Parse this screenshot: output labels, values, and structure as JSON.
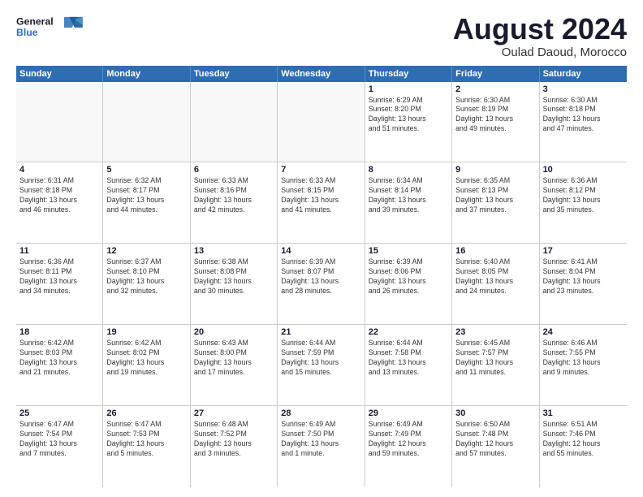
{
  "logo": {
    "text_general": "General",
    "text_blue": "Blue"
  },
  "title": {
    "month_year": "August 2024",
    "location": "Oulad Daoud, Morocco"
  },
  "header_days": [
    "Sunday",
    "Monday",
    "Tuesday",
    "Wednesday",
    "Thursday",
    "Friday",
    "Saturday"
  ],
  "weeks": [
    [
      {
        "day": "",
        "info": "",
        "empty": true
      },
      {
        "day": "",
        "info": "",
        "empty": true
      },
      {
        "day": "",
        "info": "",
        "empty": true
      },
      {
        "day": "",
        "info": "",
        "empty": true
      },
      {
        "day": "1",
        "info": "Sunrise: 6:29 AM\nSunset: 8:20 PM\nDaylight: 13 hours\nand 51 minutes.",
        "empty": false
      },
      {
        "day": "2",
        "info": "Sunrise: 6:30 AM\nSunset: 8:19 PM\nDaylight: 13 hours\nand 49 minutes.",
        "empty": false
      },
      {
        "day": "3",
        "info": "Sunrise: 6:30 AM\nSunset: 8:18 PM\nDaylight: 13 hours\nand 47 minutes.",
        "empty": false
      }
    ],
    [
      {
        "day": "4",
        "info": "Sunrise: 6:31 AM\nSunset: 8:18 PM\nDaylight: 13 hours\nand 46 minutes.",
        "empty": false
      },
      {
        "day": "5",
        "info": "Sunrise: 6:32 AM\nSunset: 8:17 PM\nDaylight: 13 hours\nand 44 minutes.",
        "empty": false
      },
      {
        "day": "6",
        "info": "Sunrise: 6:33 AM\nSunset: 8:16 PM\nDaylight: 13 hours\nand 42 minutes.",
        "empty": false
      },
      {
        "day": "7",
        "info": "Sunrise: 6:33 AM\nSunset: 8:15 PM\nDaylight: 13 hours\nand 41 minutes.",
        "empty": false
      },
      {
        "day": "8",
        "info": "Sunrise: 6:34 AM\nSunset: 8:14 PM\nDaylight: 13 hours\nand 39 minutes.",
        "empty": false
      },
      {
        "day": "9",
        "info": "Sunrise: 6:35 AM\nSunset: 8:13 PM\nDaylight: 13 hours\nand 37 minutes.",
        "empty": false
      },
      {
        "day": "10",
        "info": "Sunrise: 6:36 AM\nSunset: 8:12 PM\nDaylight: 13 hours\nand 35 minutes.",
        "empty": false
      }
    ],
    [
      {
        "day": "11",
        "info": "Sunrise: 6:36 AM\nSunset: 8:11 PM\nDaylight: 13 hours\nand 34 minutes.",
        "empty": false
      },
      {
        "day": "12",
        "info": "Sunrise: 6:37 AM\nSunset: 8:10 PM\nDaylight: 13 hours\nand 32 minutes.",
        "empty": false
      },
      {
        "day": "13",
        "info": "Sunrise: 6:38 AM\nSunset: 8:08 PM\nDaylight: 13 hours\nand 30 minutes.",
        "empty": false
      },
      {
        "day": "14",
        "info": "Sunrise: 6:39 AM\nSunset: 8:07 PM\nDaylight: 13 hours\nand 28 minutes.",
        "empty": false
      },
      {
        "day": "15",
        "info": "Sunrise: 6:39 AM\nSunset: 8:06 PM\nDaylight: 13 hours\nand 26 minutes.",
        "empty": false
      },
      {
        "day": "16",
        "info": "Sunrise: 6:40 AM\nSunset: 8:05 PM\nDaylight: 13 hours\nand 24 minutes.",
        "empty": false
      },
      {
        "day": "17",
        "info": "Sunrise: 6:41 AM\nSunset: 8:04 PM\nDaylight: 13 hours\nand 23 minutes.",
        "empty": false
      }
    ],
    [
      {
        "day": "18",
        "info": "Sunrise: 6:42 AM\nSunset: 8:03 PM\nDaylight: 13 hours\nand 21 minutes.",
        "empty": false
      },
      {
        "day": "19",
        "info": "Sunrise: 6:42 AM\nSunset: 8:02 PM\nDaylight: 13 hours\nand 19 minutes.",
        "empty": false
      },
      {
        "day": "20",
        "info": "Sunrise: 6:43 AM\nSunset: 8:00 PM\nDaylight: 13 hours\nand 17 minutes.",
        "empty": false
      },
      {
        "day": "21",
        "info": "Sunrise: 6:44 AM\nSunset: 7:59 PM\nDaylight: 13 hours\nand 15 minutes.",
        "empty": false
      },
      {
        "day": "22",
        "info": "Sunrise: 6:44 AM\nSunset: 7:58 PM\nDaylight: 13 hours\nand 13 minutes.",
        "empty": false
      },
      {
        "day": "23",
        "info": "Sunrise: 6:45 AM\nSunset: 7:57 PM\nDaylight: 13 hours\nand 11 minutes.",
        "empty": false
      },
      {
        "day": "24",
        "info": "Sunrise: 6:46 AM\nSunset: 7:55 PM\nDaylight: 13 hours\nand 9 minutes.",
        "empty": false
      }
    ],
    [
      {
        "day": "25",
        "info": "Sunrise: 6:47 AM\nSunset: 7:54 PM\nDaylight: 13 hours\nand 7 minutes.",
        "empty": false
      },
      {
        "day": "26",
        "info": "Sunrise: 6:47 AM\nSunset: 7:53 PM\nDaylight: 13 hours\nand 5 minutes.",
        "empty": false
      },
      {
        "day": "27",
        "info": "Sunrise: 6:48 AM\nSunset: 7:52 PM\nDaylight: 13 hours\nand 3 minutes.",
        "empty": false
      },
      {
        "day": "28",
        "info": "Sunrise: 6:49 AM\nSunset: 7:50 PM\nDaylight: 13 hours\nand 1 minute.",
        "empty": false
      },
      {
        "day": "29",
        "info": "Sunrise: 6:49 AM\nSunset: 7:49 PM\nDaylight: 12 hours\nand 59 minutes.",
        "empty": false
      },
      {
        "day": "30",
        "info": "Sunrise: 6:50 AM\nSunset: 7:48 PM\nDaylight: 12 hours\nand 57 minutes.",
        "empty": false
      },
      {
        "day": "31",
        "info": "Sunrise: 6:51 AM\nSunset: 7:46 PM\nDaylight: 12 hours\nand 55 minutes.",
        "empty": false
      }
    ]
  ]
}
